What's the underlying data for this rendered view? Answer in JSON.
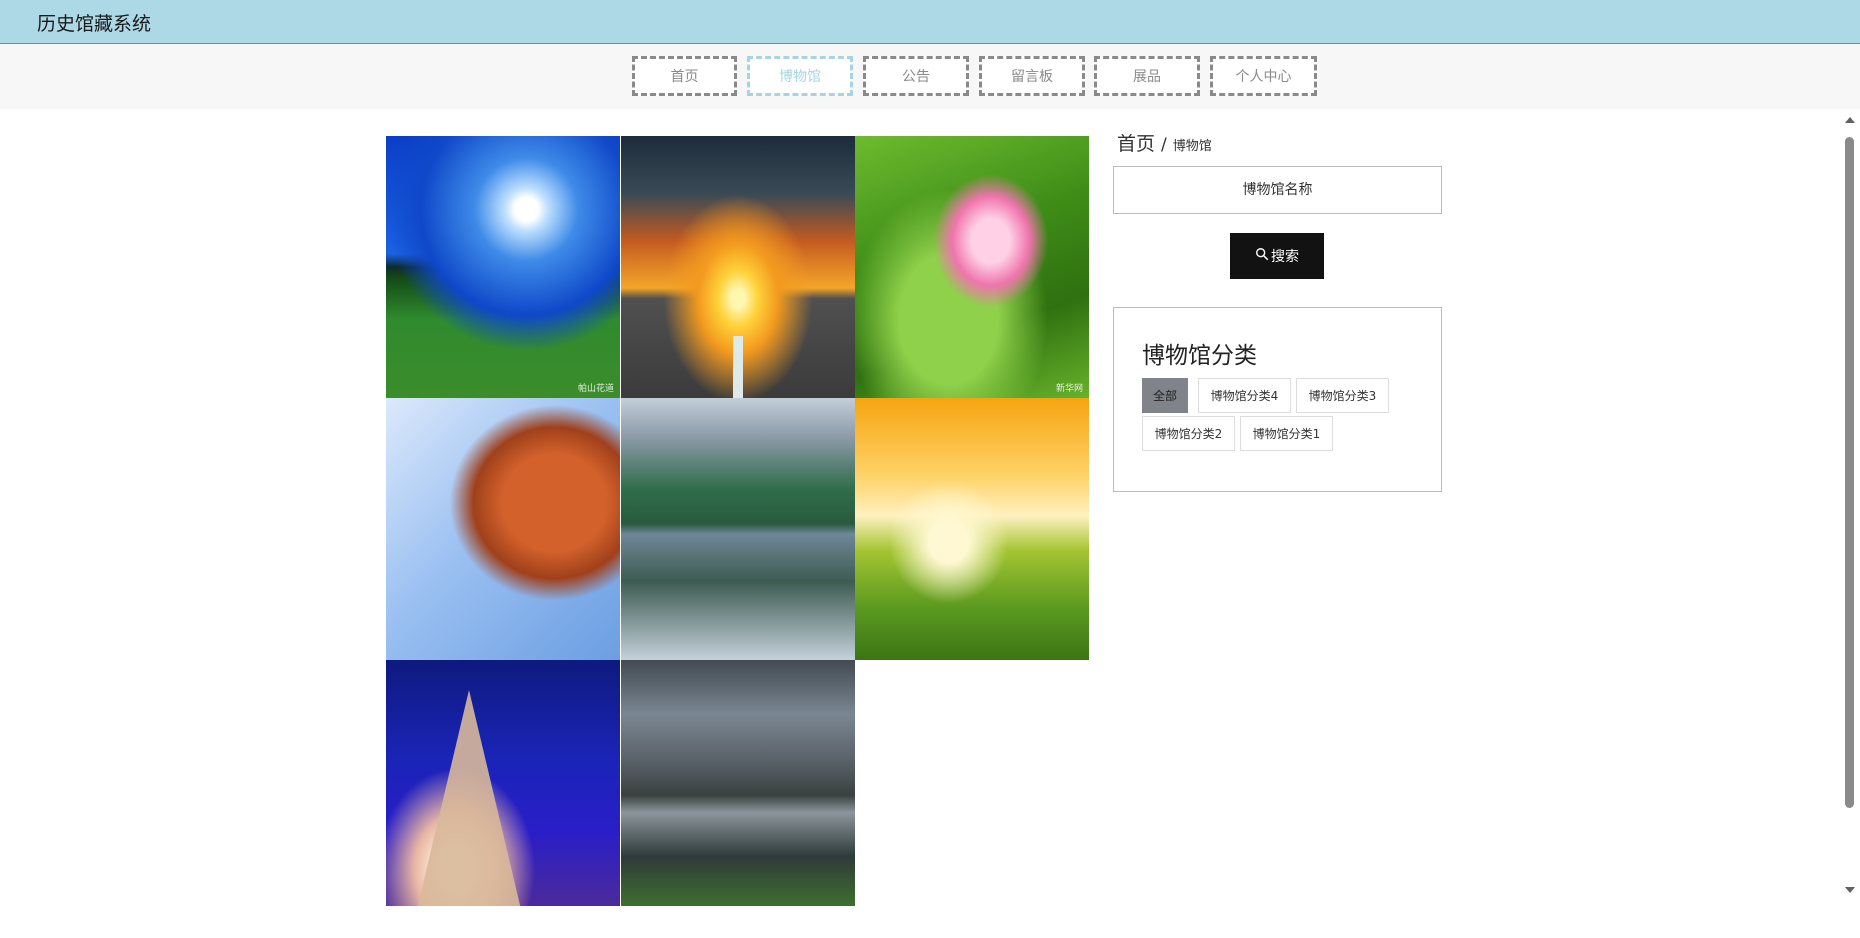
{
  "app": {
    "title": "历史馆藏系统"
  },
  "nav": {
    "items": [
      {
        "label": "首页",
        "active": false
      },
      {
        "label": "博物馆",
        "active": true
      },
      {
        "label": "公告",
        "active": false
      },
      {
        "label": "留言板",
        "active": false
      },
      {
        "label": "展品",
        "active": false
      },
      {
        "label": "个人中心",
        "active": false
      }
    ]
  },
  "breadcrumb": {
    "home": "首页",
    "separator": "/",
    "current": "博物馆"
  },
  "search": {
    "placeholder": "博物馆名称",
    "value": "",
    "button_label": "搜索",
    "button_icon": "search-icon"
  },
  "category": {
    "title": "博物馆分类",
    "tags": [
      {
        "label": "全部",
        "active": true
      },
      {
        "label": "博物馆分类4",
        "active": false
      },
      {
        "label": "博物馆分类3",
        "active": false
      },
      {
        "label": "博物馆分类2",
        "active": false
      },
      {
        "label": "博物馆分类1",
        "active": false
      }
    ]
  },
  "gallery": {
    "items": [
      {
        "subject": "moonlit meadow",
        "watermark": "帕山花道"
      },
      {
        "subject": "sunset road"
      },
      {
        "subject": "pink lotus",
        "watermark": "新华网"
      },
      {
        "subject": "autumn maple leaves"
      },
      {
        "subject": "karst mountains reflection"
      },
      {
        "subject": "daisy field sunrise"
      },
      {
        "subject": "eiffel tower night"
      },
      {
        "subject": "lakeside alpine village"
      }
    ]
  },
  "colors": {
    "header_bg": "#add8e6",
    "nav_active": "#a7d4e4",
    "button_bg": "#121212",
    "tag_active": "#808389"
  }
}
